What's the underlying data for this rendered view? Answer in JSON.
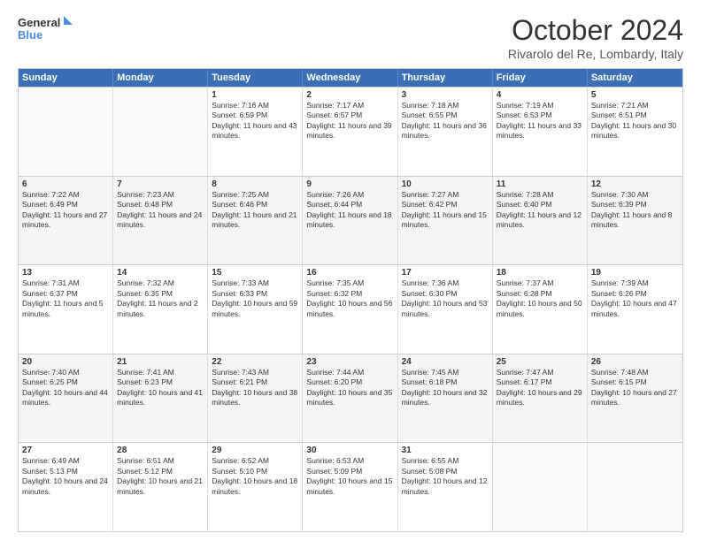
{
  "logo": {
    "general": "General",
    "blue": "Blue"
  },
  "title": "October 2024",
  "location": "Rivarolo del Re, Lombardy, Italy",
  "headers": [
    "Sunday",
    "Monday",
    "Tuesday",
    "Wednesday",
    "Thursday",
    "Friday",
    "Saturday"
  ],
  "rows": [
    [
      {
        "day": "",
        "sunrise": "",
        "sunset": "",
        "daylight": "",
        "empty": true
      },
      {
        "day": "",
        "sunrise": "",
        "sunset": "",
        "daylight": "",
        "empty": true
      },
      {
        "day": "1",
        "sunrise": "Sunrise: 7:16 AM",
        "sunset": "Sunset: 6:59 PM",
        "daylight": "Daylight: 11 hours and 43 minutes."
      },
      {
        "day": "2",
        "sunrise": "Sunrise: 7:17 AM",
        "sunset": "Sunset: 6:57 PM",
        "daylight": "Daylight: 11 hours and 39 minutes."
      },
      {
        "day": "3",
        "sunrise": "Sunrise: 7:18 AM",
        "sunset": "Sunset: 6:55 PM",
        "daylight": "Daylight: 11 hours and 36 minutes."
      },
      {
        "day": "4",
        "sunrise": "Sunrise: 7:19 AM",
        "sunset": "Sunset: 6:53 PM",
        "daylight": "Daylight: 11 hours and 33 minutes."
      },
      {
        "day": "5",
        "sunrise": "Sunrise: 7:21 AM",
        "sunset": "Sunset: 6:51 PM",
        "daylight": "Daylight: 11 hours and 30 minutes."
      }
    ],
    [
      {
        "day": "6",
        "sunrise": "Sunrise: 7:22 AM",
        "sunset": "Sunset: 6:49 PM",
        "daylight": "Daylight: 11 hours and 27 minutes."
      },
      {
        "day": "7",
        "sunrise": "Sunrise: 7:23 AM",
        "sunset": "Sunset: 6:48 PM",
        "daylight": "Daylight: 11 hours and 24 minutes."
      },
      {
        "day": "8",
        "sunrise": "Sunrise: 7:25 AM",
        "sunset": "Sunset: 6:46 PM",
        "daylight": "Daylight: 11 hours and 21 minutes."
      },
      {
        "day": "9",
        "sunrise": "Sunrise: 7:26 AM",
        "sunset": "Sunset: 6:44 PM",
        "daylight": "Daylight: 11 hours and 18 minutes."
      },
      {
        "day": "10",
        "sunrise": "Sunrise: 7:27 AM",
        "sunset": "Sunset: 6:42 PM",
        "daylight": "Daylight: 11 hours and 15 minutes."
      },
      {
        "day": "11",
        "sunrise": "Sunrise: 7:28 AM",
        "sunset": "Sunset: 6:40 PM",
        "daylight": "Daylight: 11 hours and 12 minutes."
      },
      {
        "day": "12",
        "sunrise": "Sunrise: 7:30 AM",
        "sunset": "Sunset: 6:39 PM",
        "daylight": "Daylight: 11 hours and 8 minutes."
      }
    ],
    [
      {
        "day": "13",
        "sunrise": "Sunrise: 7:31 AM",
        "sunset": "Sunset: 6:37 PM",
        "daylight": "Daylight: 11 hours and 5 minutes."
      },
      {
        "day": "14",
        "sunrise": "Sunrise: 7:32 AM",
        "sunset": "Sunset: 6:35 PM",
        "daylight": "Daylight: 11 hours and 2 minutes."
      },
      {
        "day": "15",
        "sunrise": "Sunrise: 7:33 AM",
        "sunset": "Sunset: 6:33 PM",
        "daylight": "Daylight: 10 hours and 59 minutes."
      },
      {
        "day": "16",
        "sunrise": "Sunrise: 7:35 AM",
        "sunset": "Sunset: 6:32 PM",
        "daylight": "Daylight: 10 hours and 56 minutes."
      },
      {
        "day": "17",
        "sunrise": "Sunrise: 7:36 AM",
        "sunset": "Sunset: 6:30 PM",
        "daylight": "Daylight: 10 hours and 53 minutes."
      },
      {
        "day": "18",
        "sunrise": "Sunrise: 7:37 AM",
        "sunset": "Sunset: 6:28 PM",
        "daylight": "Daylight: 10 hours and 50 minutes."
      },
      {
        "day": "19",
        "sunrise": "Sunrise: 7:39 AM",
        "sunset": "Sunset: 6:26 PM",
        "daylight": "Daylight: 10 hours and 47 minutes."
      }
    ],
    [
      {
        "day": "20",
        "sunrise": "Sunrise: 7:40 AM",
        "sunset": "Sunset: 6:25 PM",
        "daylight": "Daylight: 10 hours and 44 minutes."
      },
      {
        "day": "21",
        "sunrise": "Sunrise: 7:41 AM",
        "sunset": "Sunset: 6:23 PM",
        "daylight": "Daylight: 10 hours and 41 minutes."
      },
      {
        "day": "22",
        "sunrise": "Sunrise: 7:43 AM",
        "sunset": "Sunset: 6:21 PM",
        "daylight": "Daylight: 10 hours and 38 minutes."
      },
      {
        "day": "23",
        "sunrise": "Sunrise: 7:44 AM",
        "sunset": "Sunset: 6:20 PM",
        "daylight": "Daylight: 10 hours and 35 minutes."
      },
      {
        "day": "24",
        "sunrise": "Sunrise: 7:45 AM",
        "sunset": "Sunset: 6:18 PM",
        "daylight": "Daylight: 10 hours and 32 minutes."
      },
      {
        "day": "25",
        "sunrise": "Sunrise: 7:47 AM",
        "sunset": "Sunset: 6:17 PM",
        "daylight": "Daylight: 10 hours and 29 minutes."
      },
      {
        "day": "26",
        "sunrise": "Sunrise: 7:48 AM",
        "sunset": "Sunset: 6:15 PM",
        "daylight": "Daylight: 10 hours and 27 minutes."
      }
    ],
    [
      {
        "day": "27",
        "sunrise": "Sunrise: 6:49 AM",
        "sunset": "Sunset: 5:13 PM",
        "daylight": "Daylight: 10 hours and 24 minutes."
      },
      {
        "day": "28",
        "sunrise": "Sunrise: 6:51 AM",
        "sunset": "Sunset: 5:12 PM",
        "daylight": "Daylight: 10 hours and 21 minutes."
      },
      {
        "day": "29",
        "sunrise": "Sunrise: 6:52 AM",
        "sunset": "Sunset: 5:10 PM",
        "daylight": "Daylight: 10 hours and 18 minutes."
      },
      {
        "day": "30",
        "sunrise": "Sunrise: 6:53 AM",
        "sunset": "Sunset: 5:09 PM",
        "daylight": "Daylight: 10 hours and 15 minutes."
      },
      {
        "day": "31",
        "sunrise": "Sunrise: 6:55 AM",
        "sunset": "Sunset: 5:08 PM",
        "daylight": "Daylight: 10 hours and 12 minutes."
      },
      {
        "day": "",
        "sunrise": "",
        "sunset": "",
        "daylight": "",
        "empty": true
      },
      {
        "day": "",
        "sunrise": "",
        "sunset": "",
        "daylight": "",
        "empty": true
      }
    ]
  ]
}
